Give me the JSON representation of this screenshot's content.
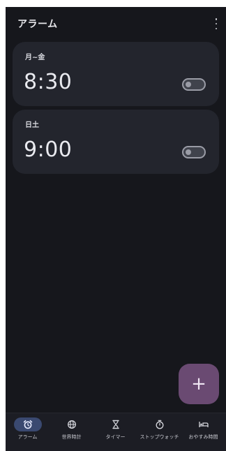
{
  "header": {
    "title": "アラーム"
  },
  "alarms": [
    {
      "days": "月~金",
      "time": "8:30",
      "enabled": false
    },
    {
      "days": "日土",
      "time": "9:00",
      "enabled": false
    }
  ],
  "fab": {
    "label": "+"
  },
  "nav": {
    "items": [
      {
        "label": "アラーム",
        "icon": "alarm-clock-icon",
        "active": true
      },
      {
        "label": "世界時計",
        "icon": "globe-icon",
        "active": false
      },
      {
        "label": "タイマー",
        "icon": "hourglass-icon",
        "active": false
      },
      {
        "label": "ストップウォッチ",
        "icon": "stopwatch-icon",
        "active": false
      },
      {
        "label": "おやすみ時間",
        "icon": "bed-icon",
        "active": false
      }
    ]
  },
  "colors": {
    "background": "#16171c",
    "card": "#23252d",
    "fab": "#6a4a72",
    "nav_active": "#3a4970"
  }
}
